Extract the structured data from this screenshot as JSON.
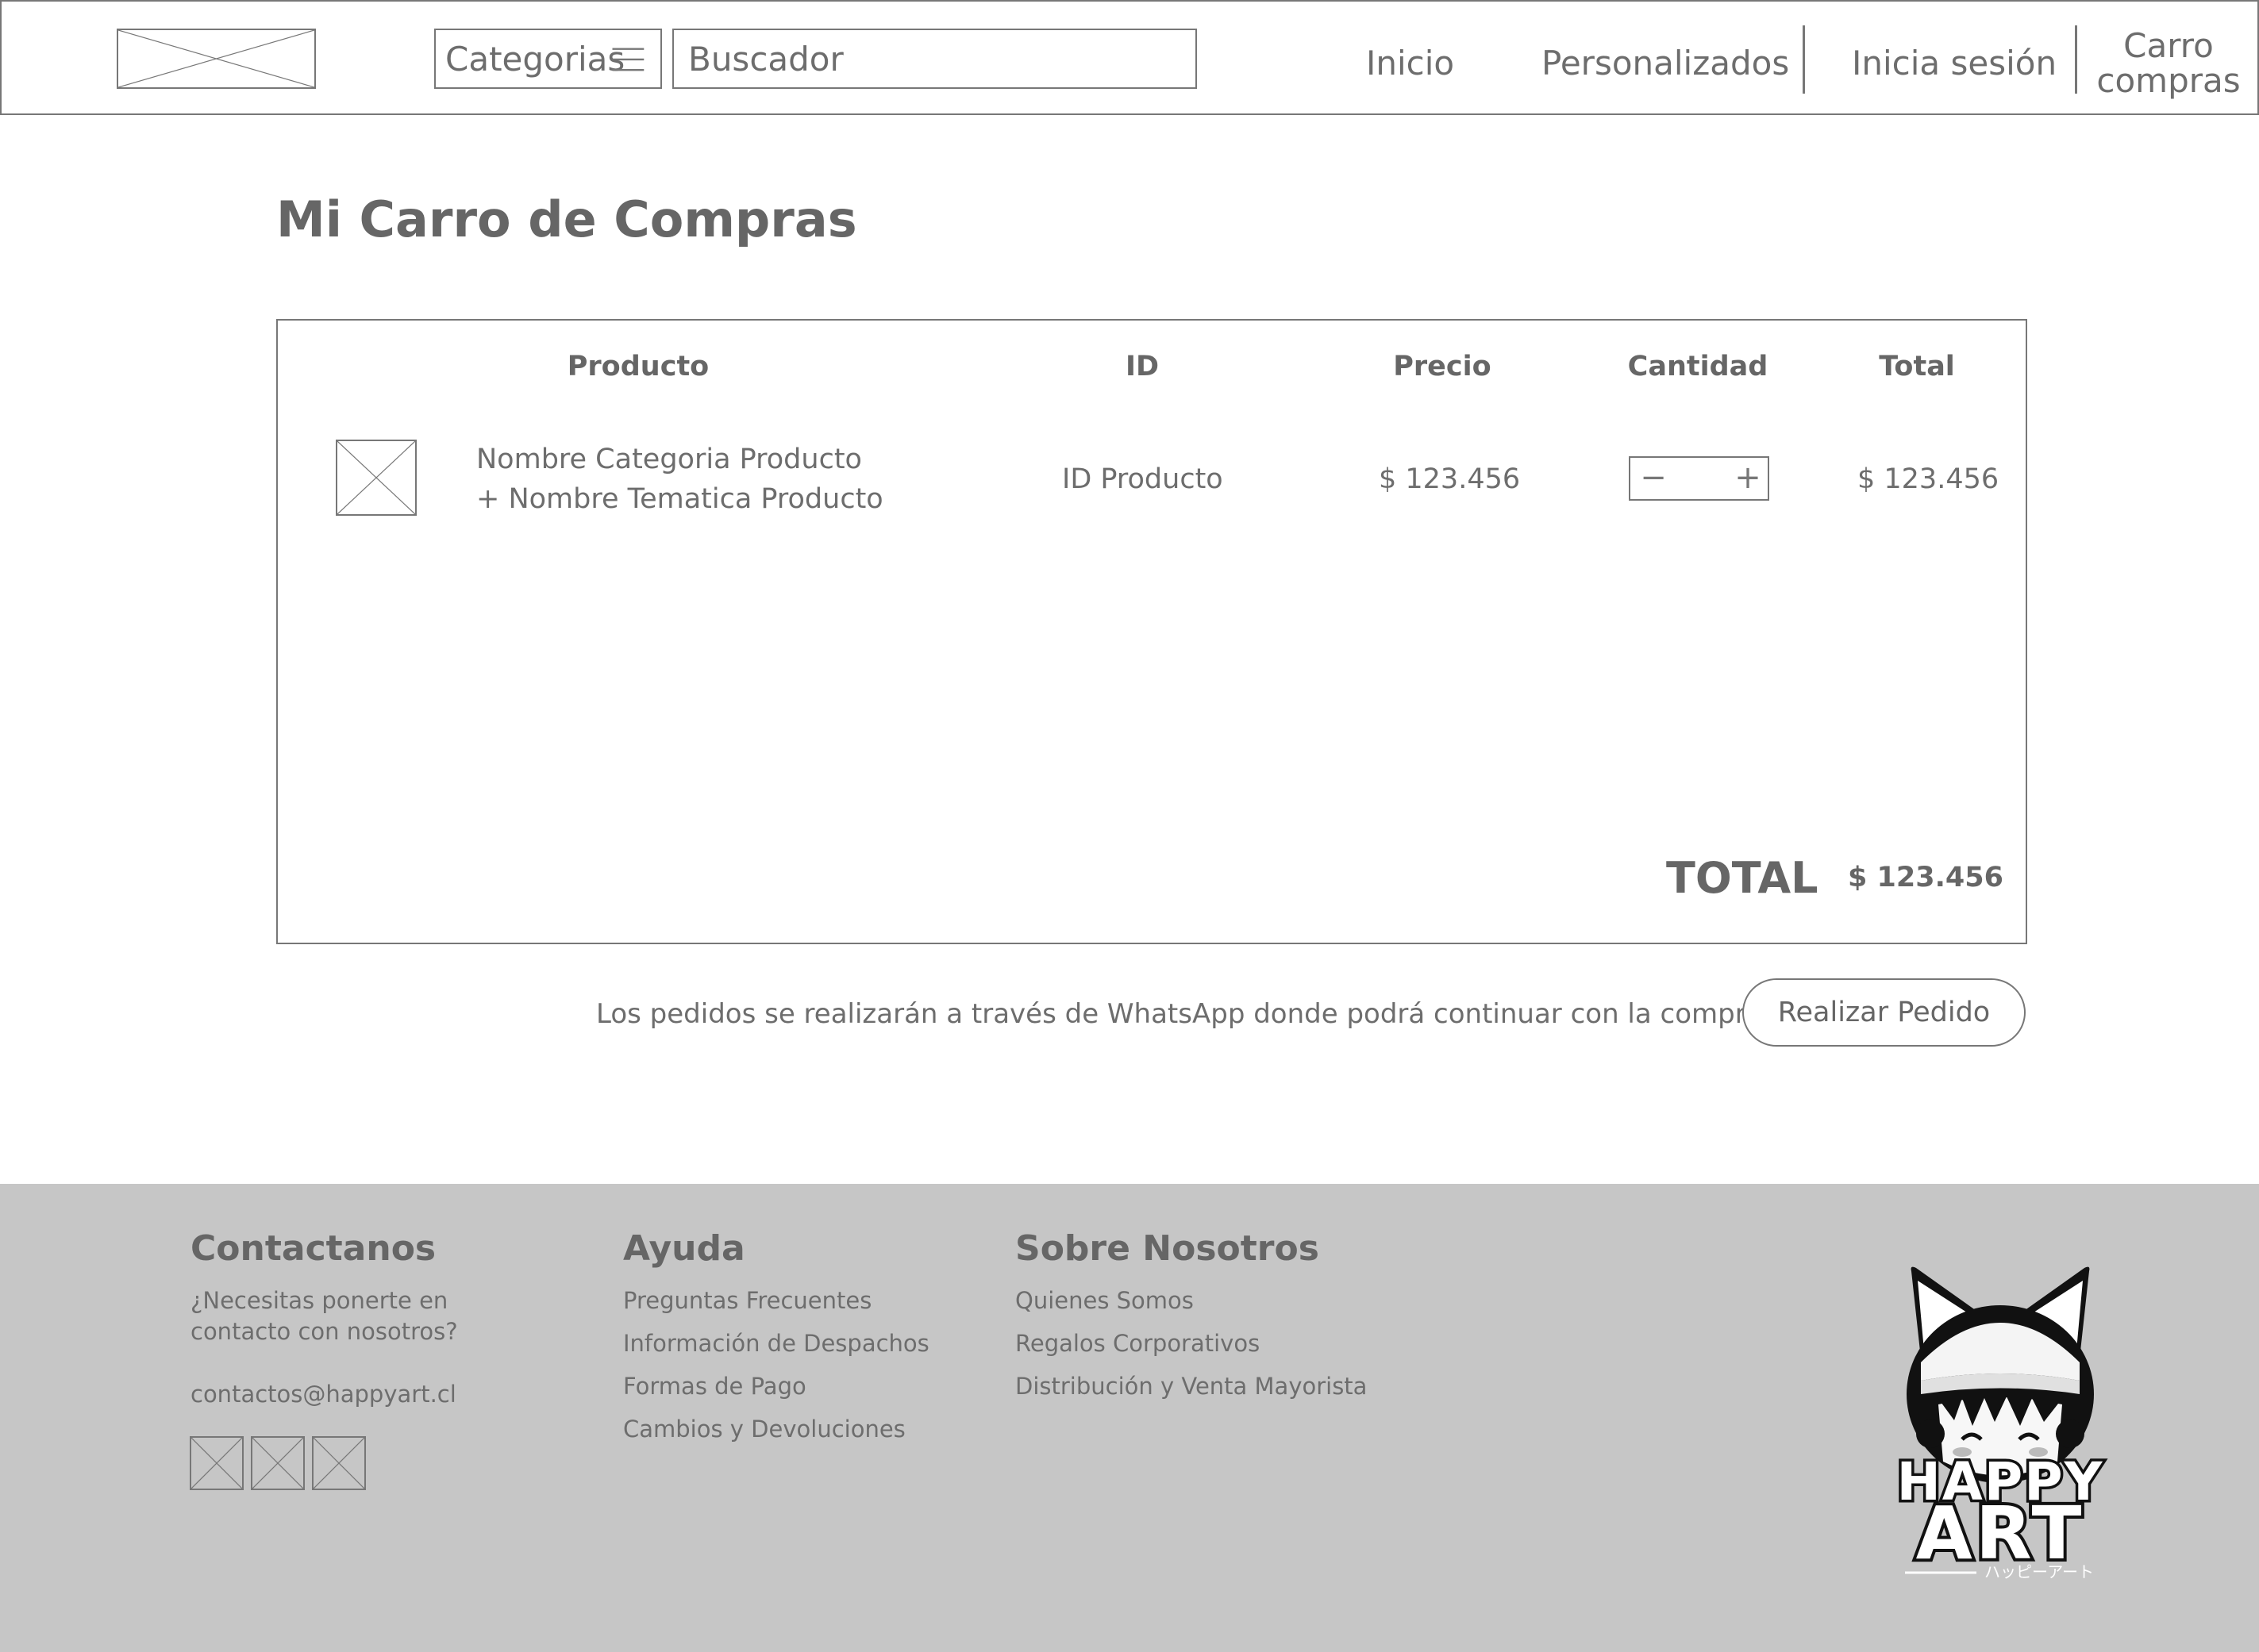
{
  "header": {
    "search_placeholder": "Buscador",
    "categories_label": "Categorias",
    "nav": {
      "inicio": "Inicio",
      "personalizados": "Personalizados",
      "login": "Inicia sesión",
      "cart_line1": "Carro",
      "cart_line2": "compras"
    }
  },
  "page": {
    "title": "Mi Carro de Compras"
  },
  "cart": {
    "columns": [
      "Producto",
      "ID",
      "Precio",
      "Cantidad",
      "Total"
    ],
    "items": [
      {
        "name_line1": "Nombre Categoria Producto",
        "name_line2": "+ Nombre Tematica Producto",
        "id": "ID Producto",
        "price": "$ 123.456",
        "quantity": "",
        "total": "$ 123.456"
      }
    ],
    "total_label": "TOTAL",
    "total_value": "$ 123.456"
  },
  "order": {
    "note": "Los pedidos se realizarán a través de WhatsApp donde podrá continuar con la compra",
    "button_label": "Realizar Pedido"
  },
  "footer": {
    "contact": {
      "heading": "Contactanos",
      "line1": "¿Necesitas ponerte en",
      "line2": "contacto con nosotros?",
      "email": "contactos@happyart.cl"
    },
    "help": {
      "heading": "Ayuda",
      "links": [
        "Preguntas Frecuentes",
        "Información de Despachos",
        "Formas de Pago",
        "Cambios y Devoluciones"
      ]
    },
    "about": {
      "heading": "Sobre Nosotros",
      "links": [
        "Quienes Somos",
        "Regalos Corporativos",
        "Distribución y Venta Mayorista"
      ]
    },
    "logo": {
      "word1": "HAPPY",
      "word2": "ART",
      "subtitle": "ハッピーアート"
    }
  },
  "colors": {
    "wire": "#777777",
    "text": "#666666",
    "footer_bg": "#c6c6c6"
  }
}
